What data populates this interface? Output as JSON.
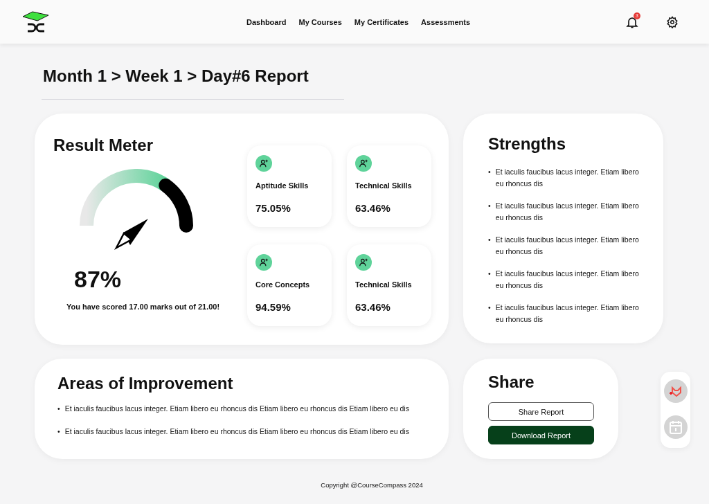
{
  "nav": {
    "links": [
      {
        "label": "Dashboard",
        "selected": false
      },
      {
        "label": "My Courses",
        "selected": false
      },
      {
        "label": "My Certificates",
        "selected": false
      },
      {
        "label": "Assessments",
        "selected": false
      }
    ],
    "notifications": "3"
  },
  "title": "Month 1 > Week 1 > Day#6 Report",
  "result": {
    "heading": "Result Meter",
    "percent": "87%",
    "summary": "You have scored 17.00 marks out of 21.00!",
    "skills": [
      {
        "label": "Aptitude Skills",
        "value": "75.05%"
      },
      {
        "label": "Technical Skills",
        "value": "63.46%"
      },
      {
        "label": "Core Concepts",
        "value": "94.59%"
      },
      {
        "label": "Technical Skills",
        "value": "63.46%"
      }
    ]
  },
  "strengths": {
    "heading": "Strengths",
    "items": [
      {
        "marker": "•",
        "text": "Et iaculis faucibus lacus integer. Etiam libero eu rhoncus dis"
      },
      {
        "marker": "•",
        "text": "Et iaculis faucibus lacus integer. Etiam libero eu rhoncus dis"
      },
      {
        "marker": "•",
        "text": "Et iaculis faucibus lacus integer. Etiam libero eu rhoncus dis"
      },
      {
        "marker": "•",
        "text": "Et iaculis faucibus lacus integer. Etiam libero eu rhoncus dis"
      },
      {
        "marker": "•",
        "text": "Et iaculis faucibus lacus integer. Etiam libero eu rhoncus dis"
      }
    ]
  },
  "improvement": {
    "heading": "Areas of Improvement",
    "items": [
      {
        "marker": "•",
        "text": "Et iaculis faucibus lacus integer. Etiam libero eu rhoncus dis Etiam libero eu rhoncus dis Etiam libero eu dis"
      },
      {
        "marker": "•",
        "text": "Et iaculis faucibus lacus integer. Etiam libero eu rhoncus dis Etiam libero eu rhoncus dis Etiam libero eu dis"
      }
    ]
  },
  "share": {
    "heading": "Share",
    "buttons": [
      {
        "label": "Share Report",
        "kind": "outline"
      },
      {
        "label": "Download Report",
        "kind": "filled"
      }
    ]
  },
  "footer": "Copyright @CourseCompass 2024"
}
